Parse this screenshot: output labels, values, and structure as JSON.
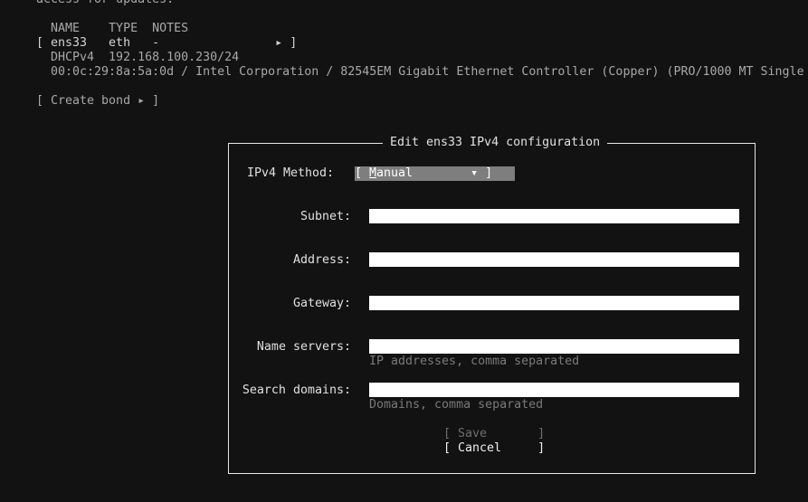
{
  "background_text": {
    "cut_line": "access for updates.",
    "header_row": "  NAME    TYPE  NOTES",
    "iface_row": "[ ens33   eth   -                ▸ ]",
    "dhcp_row": "  DHCPv4  192.168.100.230/24",
    "hw_row": "  00:0c:29:8a:5a:0d / Intel Corporation / 82545EM Gigabit Ethernet Controller (Copper) (PRO/1000 MT Single",
    "create_bond": "[ Create bond ▸ ]"
  },
  "dialog": {
    "title": "Edit ens33 IPv4 configuration",
    "method": {
      "label": "IPv4 Method:",
      "bracket_open": "[ ",
      "value_first": "M",
      "value_rest": "anual",
      "arrow": "        ▾ ]"
    },
    "fields": {
      "subnet": {
        "label": "Subnet:",
        "value": ""
      },
      "address": {
        "label": "Address:",
        "value": ""
      },
      "gateway": {
        "label": "Gateway:",
        "value": ""
      },
      "name_servers": {
        "label": "Name servers:",
        "value": "",
        "hint": "IP addresses, comma separated"
      },
      "search_domains": {
        "label": "Search domains:",
        "value": "",
        "hint": "Domains, comma separated"
      }
    },
    "buttons": {
      "save": "[ Save       ]",
      "cancel": "[ Cancel     ]"
    }
  },
  "colors": {
    "background": "#121212",
    "text": "#d4d4d4",
    "field_bg": "#ffffff",
    "select_bg": "#7e7e7e",
    "hint": "#7a7a7a"
  }
}
